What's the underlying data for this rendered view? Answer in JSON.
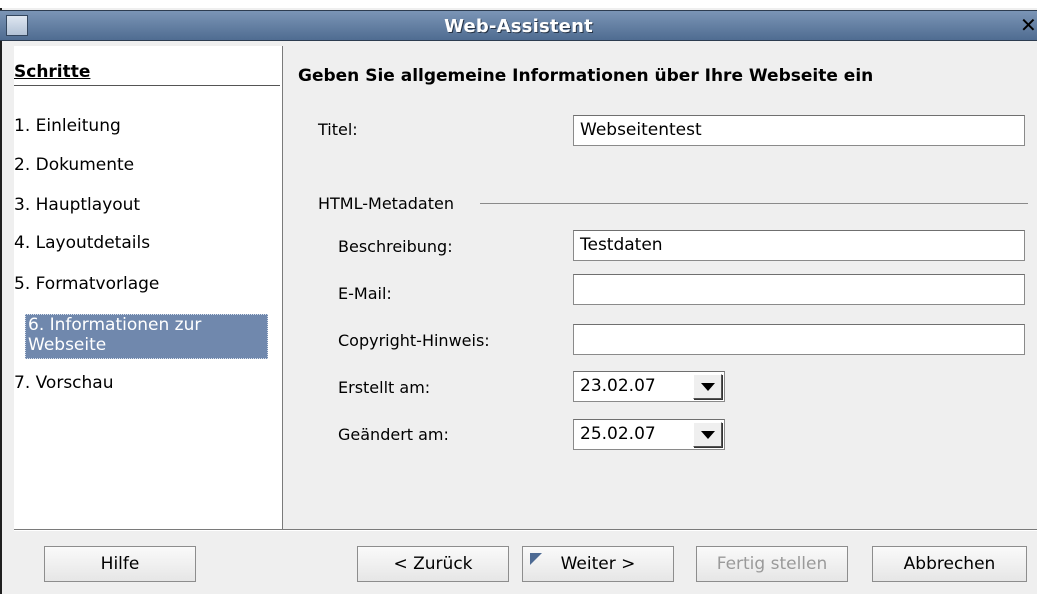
{
  "window": {
    "title": "Web-Assistent",
    "close_glyph": "✕"
  },
  "steps": {
    "heading": "Schritte",
    "items": [
      {
        "label": "1. Einleitung"
      },
      {
        "label": "2. Dokumente"
      },
      {
        "label": "3. Hauptlayout"
      },
      {
        "label": "4. Layoutdetails"
      },
      {
        "label": "5. Formatvorlage"
      },
      {
        "label": "6. Informationen zur Webseite",
        "selected": true
      },
      {
        "label": "7. Vorschau"
      }
    ]
  },
  "content": {
    "heading": "Geben Sie allgemeine Informationen über Ihre Webseite ein",
    "title_label": "Titel:",
    "title_value": "Webseitentest",
    "meta_group": "HTML-Metadaten",
    "description_label": "Beschreibung:",
    "description_value": "Testdaten",
    "email_label": "E-Mail:",
    "email_value": "",
    "copyright_label": "Copyright-Hinweis:",
    "copyright_value": "",
    "created_label": "Erstellt am:",
    "created_value": "23.02.07",
    "modified_label": "Geändert am:",
    "modified_value": "25.02.07"
  },
  "buttons": {
    "help": "Hilfe",
    "back": "< Zurück",
    "next": "Weiter >",
    "finish": "Fertig stellen",
    "cancel": "Abbrechen"
  },
  "colors": {
    "titlebar": "#5f7ba0",
    "selection": "#7088ad"
  }
}
